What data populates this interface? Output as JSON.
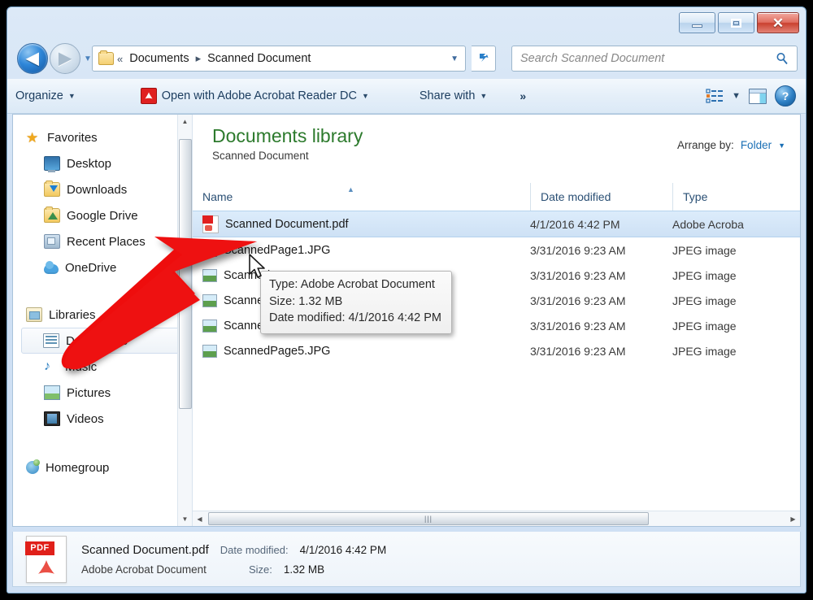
{
  "window": {
    "controls": {
      "minimize": "minimize-button",
      "maximize": "maximize-button",
      "close": "✕"
    }
  },
  "address": {
    "back_glyph": "◀",
    "forward_glyph": "▶",
    "history_caret": "▼",
    "separator_double": "«",
    "separator": "▸",
    "crumbs": [
      "Documents",
      "Scanned Document"
    ],
    "dropdown_caret": "▼"
  },
  "search": {
    "placeholder": "Search Scanned Document"
  },
  "toolbar": {
    "organize": "Organize",
    "open_with": "Open with Adobe Acrobat Reader DC",
    "acrobat_glyph": "ᴀ",
    "share_with": "Share with",
    "overflow": "»",
    "caret": "▼",
    "help_glyph": "?"
  },
  "sidebar": {
    "groups": [
      {
        "header": {
          "label": "Favorites",
          "icon": "star-icon"
        },
        "items": [
          {
            "label": "Desktop",
            "icon": "desktop-icon"
          },
          {
            "label": "Downloads",
            "icon": "downloads-folder-icon"
          },
          {
            "label": "Google Drive",
            "icon": "google-drive-icon"
          },
          {
            "label": "Recent Places",
            "icon": "recent-places-icon"
          },
          {
            "label": "OneDrive",
            "icon": "onedrive-cloud-icon"
          }
        ]
      },
      {
        "header": {
          "label": "Libraries",
          "icon": "libraries-icon"
        },
        "items": [
          {
            "label": "Documents",
            "icon": "documents-library-icon",
            "selected": true
          },
          {
            "label": "Music",
            "icon": "music-note-icon"
          },
          {
            "label": "Pictures",
            "icon": "pictures-icon"
          },
          {
            "label": "Videos",
            "icon": "videos-icon"
          }
        ]
      },
      {
        "header": {
          "label": "Homegroup",
          "icon": "homegroup-icon"
        },
        "items": []
      }
    ],
    "scroll_up": "▲",
    "scroll_down": "▼"
  },
  "library": {
    "title": "Documents library",
    "subtitle": "Scanned Document",
    "arrange_label": "Arrange by:",
    "arrange_value": "Folder",
    "arrange_caret": "▼"
  },
  "columns": {
    "name": "Name",
    "date_modified": "Date modified",
    "type": "Type",
    "sort_indicator": "▲"
  },
  "files": [
    {
      "name": "Scanned Document.pdf",
      "date": "4/1/2016 4:42 PM",
      "type": "Adobe Acroba",
      "icon": "pdf-file-icon",
      "selected": true
    },
    {
      "name": "ScannedPage1.JPG",
      "date": "3/31/2016 9:23 AM",
      "type": "JPEG image",
      "icon": "jpeg-file-icon",
      "selected": false
    },
    {
      "name": "ScannedPage2.JPG",
      "date": "3/31/2016 9:23 AM",
      "type": "JPEG image",
      "icon": "jpeg-file-icon",
      "selected": false
    },
    {
      "name": "ScannedPage3.JPG",
      "date": "3/31/2016 9:23 AM",
      "type": "JPEG image",
      "icon": "jpeg-file-icon",
      "selected": false
    },
    {
      "name": "ScannedPage4.JPG",
      "date": "3/31/2016 9:23 AM",
      "type": "JPEG image",
      "icon": "jpeg-file-icon",
      "selected": false
    },
    {
      "name": "ScannedPage5.JPG",
      "date": "3/31/2016 9:23 AM",
      "type": "JPEG image",
      "icon": "jpeg-file-icon",
      "selected": false
    }
  ],
  "tooltip": {
    "line1": "Type: Adobe Acrobat Document",
    "line2": "Size: 1.32 MB",
    "line3": "Date modified: 4/1/2016 4:42 PM"
  },
  "hscroll": {
    "left_arrow": "◀",
    "right_arrow": "▶",
    "grip": "|||"
  },
  "details": {
    "filename": "Scanned Document.pdf",
    "date_label": "Date modified:",
    "date_value": "4/1/2016 4:42 PM",
    "type": "Adobe Acrobat Document",
    "size_label": "Size:",
    "size_value": "1.32 MB",
    "pdf_tag": "PDF",
    "acrobat_glyph": "ᴀ"
  },
  "annotation": {
    "arrow_color": "#ee1111"
  }
}
